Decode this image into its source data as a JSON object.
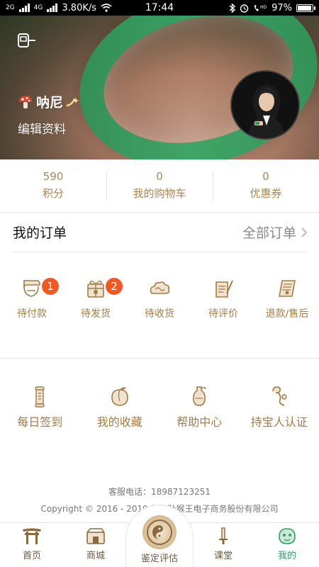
{
  "status_bar": {
    "net_type_1": "2G",
    "net_type_2": "4G",
    "speed": "3.80K/s",
    "time": "17:44",
    "battery": "97%",
    "battery_level": 0.97,
    "icons": [
      "bluetooth-icon",
      "alarm-icon",
      "hd-call-icon",
      "battery-icon"
    ]
  },
  "profile": {
    "name": "呐尼",
    "edit_label": "编辑资料",
    "left_icon": "scan-icon"
  },
  "stats": [
    {
      "value": "590",
      "label": "积分"
    },
    {
      "value": "0",
      "label": "我的购物车"
    },
    {
      "value": "0",
      "label": "优惠券"
    }
  ],
  "orders": {
    "title": "我的订单",
    "all_label": "全部订单",
    "items": [
      {
        "label": "待付款",
        "icon": "wallet-icon",
        "badge": "1"
      },
      {
        "label": "待发货",
        "icon": "gift-box-icon",
        "badge": "2"
      },
      {
        "label": "待收货",
        "icon": "cloud-icon",
        "badge": ""
      },
      {
        "label": "待评价",
        "icon": "pen-paper-icon",
        "badge": ""
      },
      {
        "label": "退款/售后",
        "icon": "refund-icon",
        "badge": ""
      }
    ]
  },
  "services": [
    {
      "label": "每日签到",
      "icon": "scroll-icon"
    },
    {
      "label": "我的收藏",
      "icon": "peach-icon"
    },
    {
      "label": "帮助中心",
      "icon": "vase-icon"
    },
    {
      "label": "持宝人认证",
      "icon": "ruyi-icon"
    }
  ],
  "footer": {
    "phone_label": "客服电话：",
    "phone": "18987123251",
    "copyright": "Copyright © 2016 - 2019 云南孙猴王电子商务股份有限公司"
  },
  "tabbar": {
    "items": [
      {
        "label": "首页",
        "icon": "gate-icon"
      },
      {
        "label": "商城",
        "icon": "shop-icon"
      },
      {
        "label": "鉴定评估",
        "icon": "bagua-icon"
      },
      {
        "label": "课堂",
        "icon": "sword-icon"
      },
      {
        "label": "我的",
        "icon": "face-icon"
      }
    ],
    "active_index": 4,
    "colors": {
      "active": "#2aa16a",
      "inactive": "#6d5a3f"
    }
  },
  "colors": {
    "accent": "#a27b49",
    "badge": "#f05a22",
    "status_bar": "#000000"
  }
}
